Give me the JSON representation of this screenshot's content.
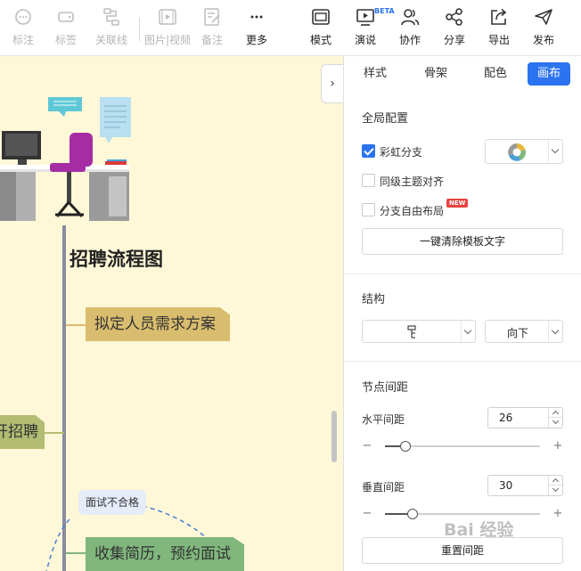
{
  "toolbar": {
    "items": [
      {
        "label": "标注",
        "icon": "comment-icon",
        "disabled": true
      },
      {
        "label": "标签",
        "icon": "tag-icon",
        "disabled": true
      },
      {
        "label": "关联线",
        "icon": "link-line-icon",
        "disabled": true
      },
      {
        "label": "图片|视频",
        "icon": "media-icon",
        "disabled": true
      },
      {
        "label": "备注",
        "icon": "note-icon",
        "disabled": true
      },
      {
        "label": "更多",
        "icon": "more-icon",
        "disabled": false
      },
      {
        "label": "模式",
        "icon": "mode-icon",
        "disabled": false
      },
      {
        "label": "演说",
        "icon": "presentation-icon",
        "disabled": false
      },
      {
        "label": "协作",
        "icon": "collaborate-icon",
        "disabled": false
      },
      {
        "label": "分享",
        "icon": "share-icon",
        "disabled": false
      },
      {
        "label": "导出",
        "icon": "export-icon",
        "disabled": false
      },
      {
        "label": "发布",
        "icon": "publish-icon",
        "disabled": false
      }
    ],
    "beta_badge": "BETA"
  },
  "canvas": {
    "root_title": "招聘流程图",
    "nodes": [
      {
        "text": "拟定人员需求方案",
        "color": "#d9bd6e"
      },
      {
        "text": "开招聘",
        "color": "#b2bc72"
      },
      {
        "text": "收集简历，预约面试",
        "color": "#7fb77c"
      }
    ],
    "callout": "面试不合格",
    "background": "#fff8d8",
    "collapse_icon": "chevron-right-icon"
  },
  "panel": {
    "tabs": [
      "样式",
      "骨架",
      "配色",
      "画布"
    ],
    "active_tab": 3,
    "global": {
      "title": "全局配置",
      "rainbow_label": "彩虹分支",
      "rainbow_checked": true,
      "align_label": "同级主题对齐",
      "align_checked": false,
      "free_label": "分支自由布局",
      "free_checked": false,
      "new_badge": "NEW",
      "clear_button": "一键清除模板文字"
    },
    "structure": {
      "title": "结构",
      "layout_icon": "tree-structure-icon",
      "direction": "向下"
    },
    "spacing": {
      "title": "节点间距",
      "horizontal_label": "水平间距",
      "horizontal_value": "26",
      "horizontal_fraction": 0.13,
      "vertical_label": "垂直间距",
      "vertical_value": "30",
      "vertical_fraction": 0.18,
      "reset_button": "重置间距"
    }
  },
  "watermark": "Bai 经验"
}
